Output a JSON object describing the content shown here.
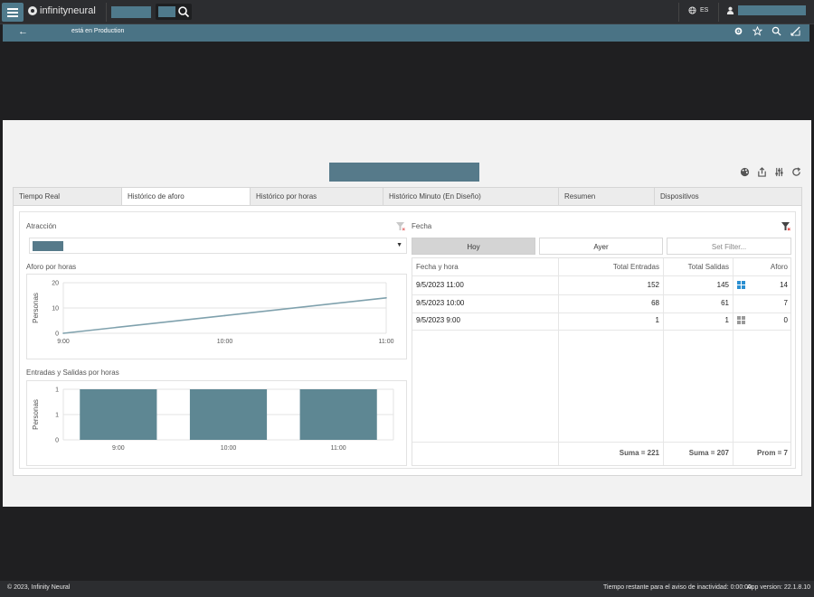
{
  "app": {
    "brand": "infinityneural",
    "language": "ES"
  },
  "subbar": {
    "status": "está en Production"
  },
  "tabs": [
    {
      "label": "Tiempo Real"
    },
    {
      "label": "Histórico de aforo"
    },
    {
      "label": "Histórico por horas"
    },
    {
      "label": "Histórico Minuto (En Diseño)"
    },
    {
      "label": "Resumen"
    },
    {
      "label": "Dispositivos"
    }
  ],
  "filters": {
    "atraccion_label": "Atracción",
    "fecha_label": "Fecha",
    "btn_hoy": "Hoy",
    "btn_ayer": "Ayer",
    "set_filter_placeholder": "Set Filter..."
  },
  "chart_aforo_title": "Aforo por horas",
  "chart_es_title": "Entradas y Salidas por horas",
  "chart_data": [
    {
      "type": "line",
      "x": [
        "9:00",
        "10:00",
        "11:00"
      ],
      "series": [
        {
          "values": [
            0,
            7,
            14
          ]
        }
      ],
      "ylabel": "Personas",
      "ylim": [
        0,
        20
      ],
      "yticks": [
        0,
        10,
        20
      ],
      "grid": true,
      "color": "#7fa1ad"
    },
    {
      "type": "bar",
      "categories": [
        "9:00",
        "10:00",
        "11:00"
      ],
      "values": [
        1,
        1,
        1
      ],
      "ylabel": "Personas",
      "ylim": [
        0,
        1
      ],
      "yticks": [
        0,
        1,
        1
      ],
      "grid": true,
      "color": "#5e8793"
    }
  ],
  "table": {
    "headers": [
      "Fecha y hora",
      "Total Entradas",
      "Total Salidas",
      "Aforo"
    ],
    "rows": [
      {
        "fecha": "9/5/2023 11:00",
        "entradas": "152",
        "salidas": "145",
        "aforo": "14",
        "icon": "grid-icon-blue"
      },
      {
        "fecha": "9/5/2023 10:00",
        "entradas": "68",
        "salidas": "61",
        "aforo": "7",
        "icon": ""
      },
      {
        "fecha": "9/5/2023 9:00",
        "entradas": "1",
        "salidas": "1",
        "aforo": "0",
        "icon": "grid-icon-gray"
      }
    ],
    "footer": {
      "entradas": "Suma = 221",
      "salidas": "Suma = 207",
      "aforo": "Prom = 7"
    }
  },
  "colors": {
    "accent": "#4f7a8c",
    "icon_blue": "#2a8fd1",
    "icon_gray": "#9a9a9a"
  },
  "footer": {
    "copyright": "© 2023, Infinity Neural",
    "inactivity": "Tiempo restante para el aviso de inactividad: 0:00:00",
    "version": "App version: 22.1.8.10"
  }
}
